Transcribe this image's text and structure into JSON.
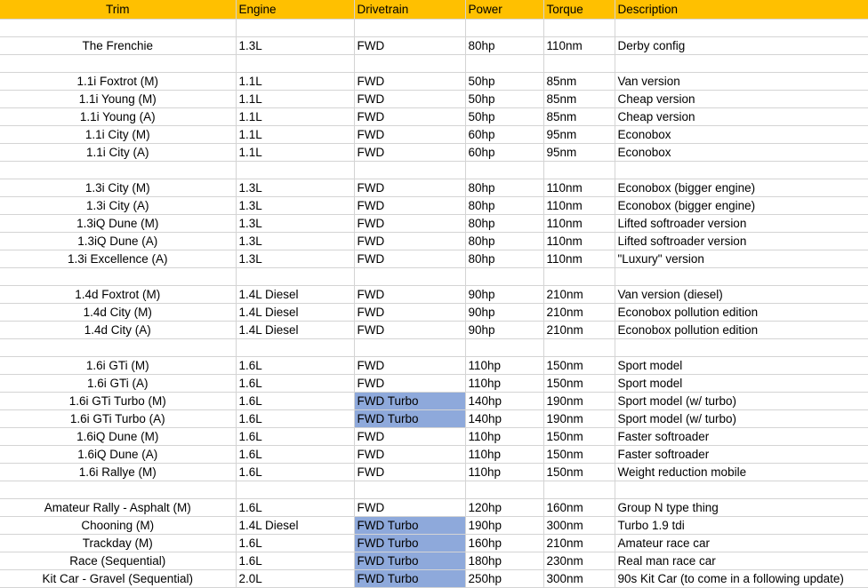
{
  "columns": [
    "Trim",
    "Engine",
    "Drivetrain",
    "Power",
    "Torque",
    "Description"
  ],
  "colors": {
    "header_bg": "#ffc000",
    "turbo_highlight": "#8ea9db",
    "gridline": "#d4d4d4"
  },
  "rows": [
    {
      "blank": true
    },
    {
      "trim": "The Frenchie",
      "engine": "1.3L",
      "drivetrain": "FWD",
      "power": "80hp",
      "torque": "110nm",
      "description": "Derby config"
    },
    {
      "blank": true
    },
    {
      "trim": "1.1i Foxtrot (M)",
      "engine": "1.1L",
      "drivetrain": "FWD",
      "power": "50hp",
      "torque": "85nm",
      "description": "Van version"
    },
    {
      "trim": "1.1i Young (M)",
      "engine": "1.1L",
      "drivetrain": "FWD",
      "power": "50hp",
      "torque": "85nm",
      "description": "Cheap version"
    },
    {
      "trim": "1.1i Young (A)",
      "engine": "1.1L",
      "drivetrain": "FWD",
      "power": "50hp",
      "torque": "85nm",
      "description": "Cheap version"
    },
    {
      "trim": "1.1i City (M)",
      "engine": "1.1L",
      "drivetrain": "FWD",
      "power": "60hp",
      "torque": "95nm",
      "description": "Econobox"
    },
    {
      "trim": "1.1i City (A)",
      "engine": "1.1L",
      "drivetrain": "FWD",
      "power": "60hp",
      "torque": "95nm",
      "description": "Econobox"
    },
    {
      "blank": true
    },
    {
      "trim": "1.3i City (M)",
      "engine": "1.3L",
      "drivetrain": "FWD",
      "power": "80hp",
      "torque": "110nm",
      "description": "Econobox (bigger engine)"
    },
    {
      "trim": "1.3i City (A)",
      "engine": "1.3L",
      "drivetrain": "FWD",
      "power": "80hp",
      "torque": "110nm",
      "description": "Econobox (bigger engine)"
    },
    {
      "trim": "1.3iQ Dune (M)",
      "engine": "1.3L",
      "drivetrain": "FWD",
      "power": "80hp",
      "torque": "110nm",
      "description": "Lifted softroader version"
    },
    {
      "trim": "1.3iQ Dune (A)",
      "engine": "1.3L",
      "drivetrain": "FWD",
      "power": "80hp",
      "torque": "110nm",
      "description": "Lifted softroader version"
    },
    {
      "trim": "1.3i Excellence (A)",
      "engine": "1.3L",
      "drivetrain": "FWD",
      "power": "80hp",
      "torque": "110nm",
      "description": "\"Luxury\" version"
    },
    {
      "blank": true
    },
    {
      "trim": "1.4d Foxtrot (M)",
      "engine": "1.4L Diesel",
      "drivetrain": "FWD",
      "power": "90hp",
      "torque": "210nm",
      "description": "Van version (diesel)"
    },
    {
      "trim": "1.4d City (M)",
      "engine": "1.4L Diesel",
      "drivetrain": "FWD",
      "power": "90hp",
      "torque": "210nm",
      "description": "Econobox pollution edition"
    },
    {
      "trim": "1.4d City (A)",
      "engine": "1.4L Diesel",
      "drivetrain": "FWD",
      "power": "90hp",
      "torque": "210nm",
      "description": "Econobox pollution edition"
    },
    {
      "blank": true
    },
    {
      "trim": "1.6i GTi (M)",
      "engine": "1.6L",
      "drivetrain": "FWD",
      "power": "110hp",
      "torque": "150nm",
      "description": "Sport model"
    },
    {
      "trim": "1.6i GTi (A)",
      "engine": "1.6L",
      "drivetrain": "FWD",
      "power": "110hp",
      "torque": "150nm",
      "description": "Sport model"
    },
    {
      "trim": "1.6i GTi Turbo (M)",
      "engine": "1.6L",
      "drivetrain": "FWD Turbo",
      "turbo": true,
      "power": "140hp",
      "torque": "190nm",
      "description": "Sport model (w/ turbo)"
    },
    {
      "trim": "1.6i GTi Turbo (A)",
      "engine": "1.6L",
      "drivetrain": "FWD Turbo",
      "turbo": true,
      "power": "140hp",
      "torque": "190nm",
      "description": "Sport model (w/ turbo)"
    },
    {
      "trim": "1.6iQ Dune (M)",
      "engine": "1.6L",
      "drivetrain": "FWD",
      "power": "110hp",
      "torque": "150nm",
      "description": "Faster softroader"
    },
    {
      "trim": "1.6iQ Dune (A)",
      "engine": "1.6L",
      "drivetrain": "FWD",
      "power": "110hp",
      "torque": "150nm",
      "description": "Faster softroader"
    },
    {
      "trim": "1.6i Rallye (M)",
      "engine": "1.6L",
      "drivetrain": "FWD",
      "power": "110hp",
      "torque": "150nm",
      "description": "Weight reduction mobile"
    },
    {
      "blank": true
    },
    {
      "trim": "Amateur Rally - Asphalt (M)",
      "engine": "1.6L",
      "drivetrain": "FWD",
      "power": "120hp",
      "torque": "160nm",
      "description": "Group N type thing"
    },
    {
      "trim": "Chooning (M)",
      "engine": "1.4L Diesel",
      "drivetrain": "FWD Turbo",
      "turbo": true,
      "power": "190hp",
      "torque": "300nm",
      "description": "Turbo 1.9 tdi"
    },
    {
      "trim": "Trackday (M)",
      "engine": "1.6L",
      "drivetrain": "FWD Turbo",
      "turbo": true,
      "power": "160hp",
      "torque": "210nm",
      "description": "Amateur race car"
    },
    {
      "trim": "Race (Sequential)",
      "engine": "1.6L",
      "drivetrain": "FWD Turbo",
      "turbo": true,
      "power": "180hp",
      "torque": "230nm",
      "description": "Real man race car"
    },
    {
      "trim": "Kit Car - Gravel (Sequential)",
      "engine": "2.0L",
      "drivetrain": "FWD Turbo",
      "turbo": true,
      "power": "250hp",
      "torque": "300nm",
      "description": "90s Kit Car (to come in a following update)"
    }
  ]
}
